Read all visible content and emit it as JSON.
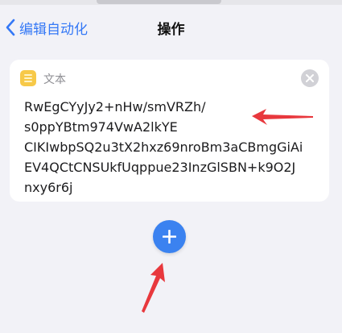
{
  "nav": {
    "back_label": "编辑自动化",
    "title": "操作"
  },
  "action_card": {
    "title": "文本",
    "icon": "note-icon",
    "text_lines": [
      "RwEgCYyJy2+nHw/smVRZh/",
      "s0ppYBtm974VwA2lkYE",
      "CIKIwbpSQ2u3tX2hxz69nroBm3aCBmgGiAi",
      "EV4QCtCNSUkfUqppue23InzGlSBN+k9O2J",
      "nxy6r6j"
    ]
  },
  "add_button": {
    "icon": "plus-icon"
  },
  "colors": {
    "accent": "#3478f6",
    "add_button": "#3b82f0",
    "note_icon": "#f7c948",
    "annotation_arrow": "#e8383d"
  }
}
